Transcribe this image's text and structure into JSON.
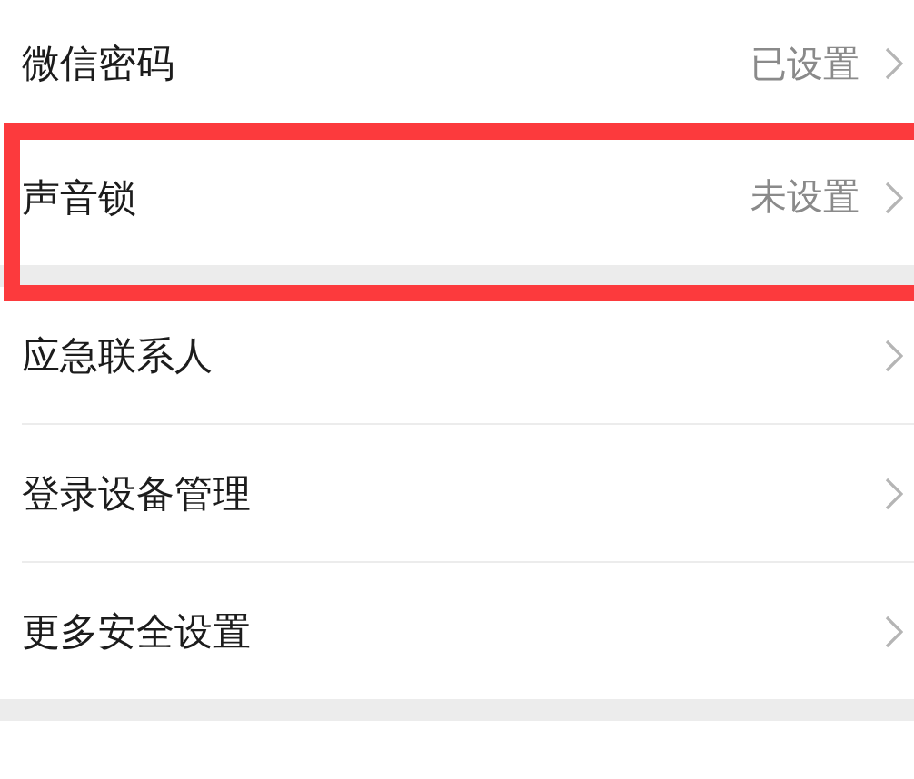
{
  "sections": [
    {
      "items": [
        {
          "label": "微信密码",
          "value": "已设置",
          "highlighted": false
        },
        {
          "label": "声音锁",
          "value": "未设置",
          "highlighted": true
        }
      ]
    },
    {
      "items": [
        {
          "label": "应急联系人",
          "highlighted": false
        },
        {
          "label": "登录设备管理",
          "highlighted": false
        },
        {
          "label": "更多安全设置",
          "highlighted": false
        }
      ]
    }
  ]
}
